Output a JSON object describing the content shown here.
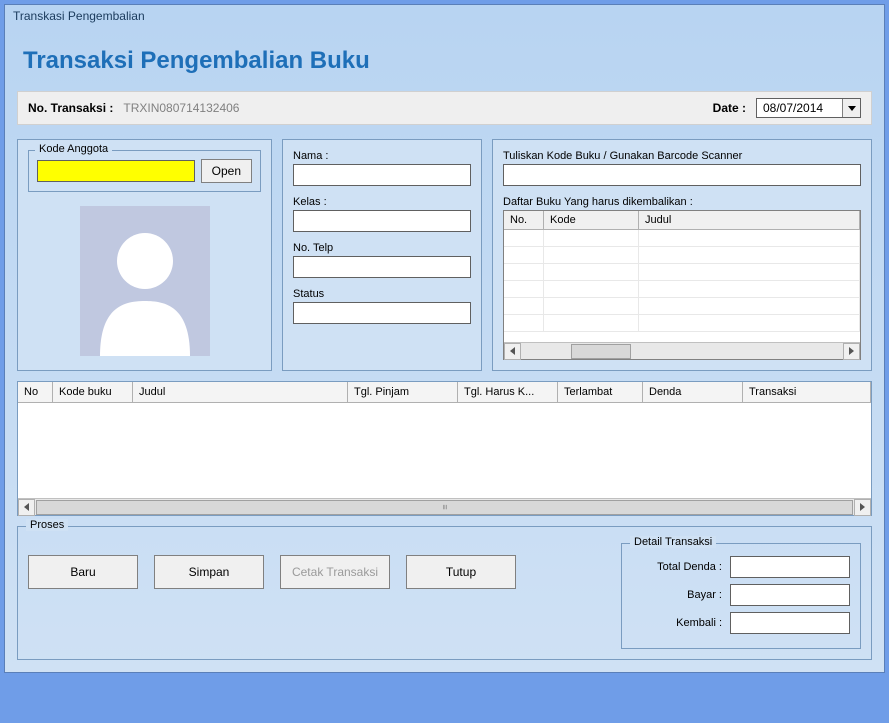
{
  "window": {
    "title": "Transkasi Pengembalian"
  },
  "header": {
    "title": "Transaksi Pengembalian Buku"
  },
  "txn": {
    "label": "No. Transaksi :",
    "value": "TRXIN080714132406",
    "date_label": "Date :",
    "date_value": "08/07/2014"
  },
  "left": {
    "legend": "Kode Anggota",
    "open_btn": "Open"
  },
  "mid": {
    "nama": "Nama :",
    "kelas": "Kelas :",
    "telp": "No. Telp",
    "status": "Status"
  },
  "right": {
    "scanner_label": "Tuliskan Kode Buku / Gunakan Barcode Scanner",
    "list_label": "Daftar Buku Yang harus dikembalikan :",
    "cols": {
      "no": "No.",
      "kode": "Kode",
      "judul": "Judul"
    }
  },
  "maingrid": {
    "cols": {
      "no": "No",
      "kode": "Kode buku",
      "judul": "Judul",
      "tgl_pinjam": "Tgl. Pinjam",
      "tgl_harus": "Tgl. Harus K...",
      "terlambat": "Terlambat",
      "denda": "Denda",
      "transaksi": "Transaksi"
    }
  },
  "proses": {
    "legend": "Proses",
    "baru": "Baru",
    "simpan": "Simpan",
    "cetak": "Cetak Transaksi",
    "tutup": "Tutup",
    "detail_legend": "Detail Transaksi",
    "total_denda": "Total Denda :",
    "bayar": "Bayar :",
    "kembali": "Kembali :"
  }
}
